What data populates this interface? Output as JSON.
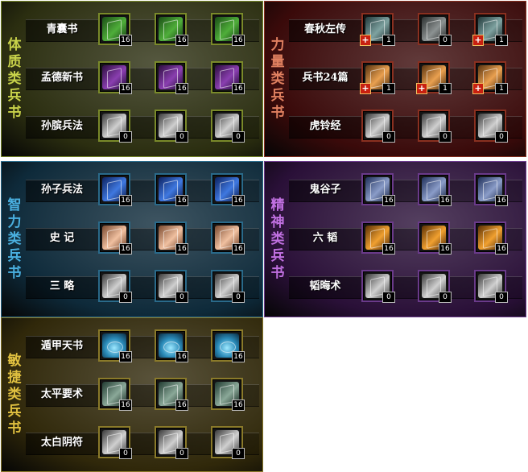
{
  "panels": [
    {
      "category": "体质类兵书",
      "theme": {
        "bg": "#2b2e10",
        "accent": "#c8d24a",
        "border": "#7a8a2a"
      },
      "rows": [
        {
          "name": "青囊书",
          "items": [
            {
              "icon": "green-book-icon",
              "count": "16"
            },
            {
              "icon": "green-book-icon",
              "count": "16"
            },
            {
              "icon": "green-book-icon",
              "count": "16"
            }
          ]
        },
        {
          "name": "孟德新书",
          "items": [
            {
              "icon": "purple-book-icon",
              "count": "16"
            },
            {
              "icon": "purple-book-icon",
              "count": "16"
            },
            {
              "icon": "purple-book-icon",
              "count": "16"
            }
          ]
        },
        {
          "name": "孙膑兵法",
          "items": [
            {
              "icon": "grey-scroll-icon",
              "count": "0"
            },
            {
              "icon": "grey-scroll-icon",
              "count": "0"
            },
            {
              "icon": "grey-scroll-icon",
              "count": "0"
            }
          ]
        }
      ]
    },
    {
      "category": "力量类兵书",
      "theme": {
        "bg": "#3a0a0a",
        "accent": "#e08060",
        "border": "#8a3020"
      },
      "rows": [
        {
          "name": "春秋左传",
          "items": [
            {
              "icon": "teal-book-icon",
              "count": "1",
              "plus": true
            },
            {
              "icon": "grey-book-icon",
              "count": "0"
            },
            {
              "icon": "teal-book-icon",
              "count": "1",
              "plus": true
            }
          ]
        },
        {
          "name": "兵书24篇",
          "items": [
            {
              "icon": "orange-book-icon",
              "count": "1",
              "plus": true
            },
            {
              "icon": "orange-book-icon",
              "count": "1",
              "plus": true
            },
            {
              "icon": "orange-book-icon",
              "count": "1",
              "plus": true
            }
          ]
        },
        {
          "name": "虎铃经",
          "items": [
            {
              "icon": "grey-scroll-icon",
              "count": "0"
            },
            {
              "icon": "grey-scroll-icon",
              "count": "0"
            },
            {
              "icon": "grey-scroll-icon",
              "count": "0"
            }
          ]
        }
      ]
    },
    {
      "category": "智力类兵书",
      "theme": {
        "bg": "#0e2a3a",
        "accent": "#4ab0e0",
        "border": "#2a6a8a"
      },
      "rows": [
        {
          "name": "孙子兵法",
          "items": [
            {
              "icon": "blue-book-icon",
              "count": "16"
            },
            {
              "icon": "blue-book-icon",
              "count": "16"
            },
            {
              "icon": "blue-book-icon",
              "count": "16"
            }
          ]
        },
        {
          "name": "史 记",
          "items": [
            {
              "icon": "peach-book-icon",
              "count": "16"
            },
            {
              "icon": "peach-book-icon",
              "count": "16"
            },
            {
              "icon": "peach-book-icon",
              "count": "16"
            }
          ]
        },
        {
          "name": "三 略",
          "items": [
            {
              "icon": "grey-scroll-icon",
              "count": "0"
            },
            {
              "icon": "grey-scroll-icon",
              "count": "0"
            },
            {
              "icon": "grey-scroll-icon",
              "count": "0"
            }
          ]
        }
      ]
    },
    {
      "category": "精神类兵书",
      "theme": {
        "bg": "#2a1038",
        "accent": "#c070e0",
        "border": "#6a3a8a"
      },
      "rows": [
        {
          "name": "鬼谷子",
          "items": [
            {
              "icon": "slate-book-icon",
              "count": "16"
            },
            {
              "icon": "slate-book-icon",
              "count": "16"
            },
            {
              "icon": "slate-book-icon",
              "count": "16"
            }
          ]
        },
        {
          "name": "六 韬",
          "items": [
            {
              "icon": "gold-scroll-icon",
              "count": "16"
            },
            {
              "icon": "gold-scroll-icon",
              "count": "16"
            },
            {
              "icon": "gold-scroll-icon",
              "count": "16"
            }
          ]
        },
        {
          "name": "韬晦术",
          "items": [
            {
              "icon": "grey-scroll-icon",
              "count": "0"
            },
            {
              "icon": "grey-scroll-icon",
              "count": "0"
            },
            {
              "icon": "grey-scroll-icon",
              "count": "0"
            }
          ]
        }
      ]
    },
    {
      "category": "敏捷类兵书",
      "theme": {
        "bg": "#30280a",
        "accent": "#e0c040",
        "border": "#8a7a2a"
      },
      "rows": [
        {
          "name": "遁甲天书",
          "items": [
            {
              "icon": "cyan-lotus-icon",
              "count": "16"
            },
            {
              "icon": "cyan-lotus-icon",
              "count": "16"
            },
            {
              "icon": "cyan-lotus-icon",
              "count": "16"
            }
          ]
        },
        {
          "name": "太平要术",
          "items": [
            {
              "icon": "sage-book-icon",
              "count": "16"
            },
            {
              "icon": "sage-book-icon",
              "count": "16"
            },
            {
              "icon": "sage-book-icon",
              "count": "16"
            }
          ]
        },
        {
          "name": "太白阴符",
          "items": [
            {
              "icon": "grey-scroll-icon",
              "count": "0"
            },
            {
              "icon": "grey-scroll-icon",
              "count": "0"
            },
            {
              "icon": "grey-scroll-icon",
              "count": "0"
            }
          ]
        }
      ]
    }
  ]
}
